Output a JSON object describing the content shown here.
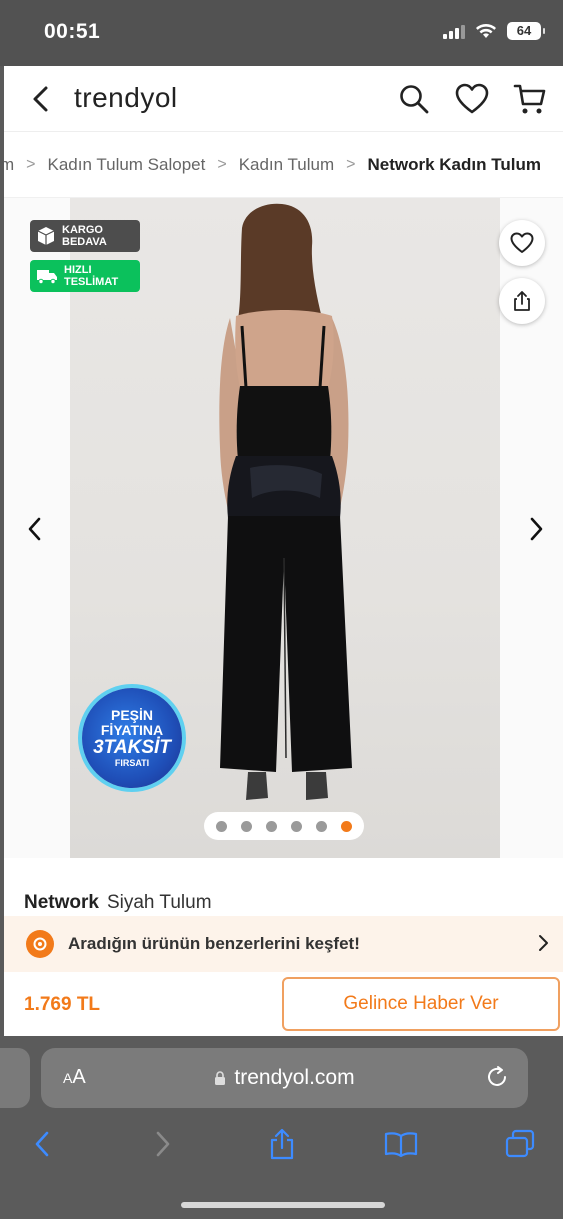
{
  "status_bar": {
    "time": "00:51",
    "battery": "64"
  },
  "header": {
    "brand": "trendyol",
    "icons": [
      "back-chevron-icon",
      "search-icon",
      "heart-icon",
      "cart-icon"
    ]
  },
  "breadcrumb": {
    "items": [
      "m",
      "Kadın Tulum Salopet",
      "Kadın Tulum"
    ],
    "separator": ">",
    "current": "Network Kadın Tulum"
  },
  "gallery": {
    "badges": {
      "cargo": {
        "line1": "KARGO",
        "line2": "BEDAVA"
      },
      "fast": {
        "line1": "HIZLI",
        "line2": "TESLİMAT"
      }
    },
    "promo": {
      "line1": "PEŞİN",
      "line2": "FİYATINA",
      "line3": "3TAKSİT",
      "line4": "FIRSATI"
    },
    "dots_total": 6,
    "dots_active_index": 5
  },
  "product": {
    "brand": "Network",
    "name": "Siyah Tulum"
  },
  "discover": {
    "text": "Aradığın ürünün benzerlerini keşfet!"
  },
  "price_bar": {
    "price": "1.769 TL",
    "notify_label": "Gelince Haber Ver"
  },
  "safari": {
    "aa_small": "A",
    "aa_large": "A",
    "url": "trendyol.com"
  },
  "colors": {
    "accent": "#f27a1a",
    "fast_badge": "#0bc15c",
    "cargo_badge": "#4d4d4d",
    "safari_blue": "#3d8bff"
  }
}
